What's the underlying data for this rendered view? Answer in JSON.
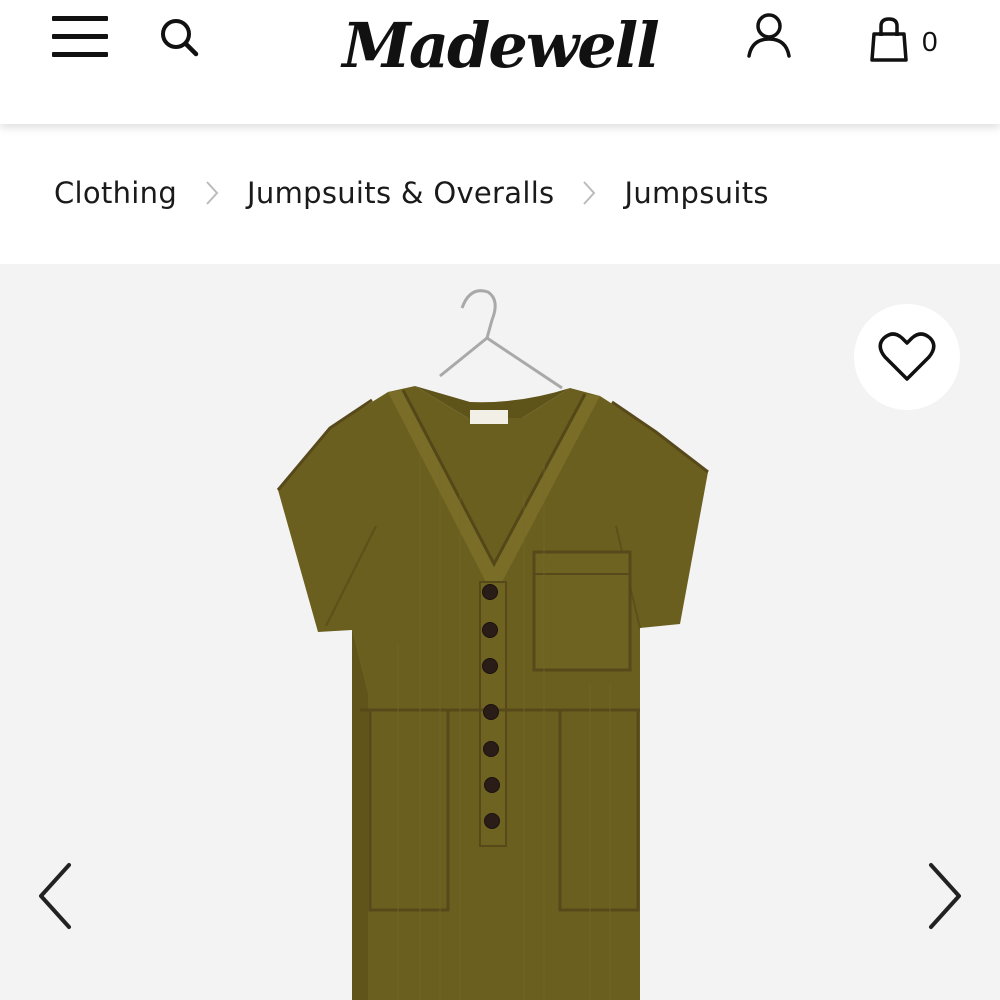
{
  "header": {
    "logo_text": "Madewell",
    "bag_count": "0",
    "icons": {
      "menu": "hamburger-icon",
      "search": "search-icon",
      "account": "user-icon",
      "bag": "shopping-bag-icon"
    }
  },
  "breadcrumb": {
    "items": [
      {
        "label": "Clothing"
      },
      {
        "label": "Jumpsuits & Overalls"
      },
      {
        "label": "Jumpsuits"
      }
    ],
    "separator_icon": "chevron-right-icon"
  },
  "product": {
    "image_subject": "olive-green-jumpsuit-on-hanger",
    "colors": {
      "fabric": "#6b5f1f",
      "background": "#f3f3f3",
      "buttons": "#2a1d18"
    }
  },
  "gallery": {
    "favorite_icon": "heart-outline-icon",
    "prev_icon": "chevron-left-icon",
    "next_icon": "chevron-right-icon"
  }
}
